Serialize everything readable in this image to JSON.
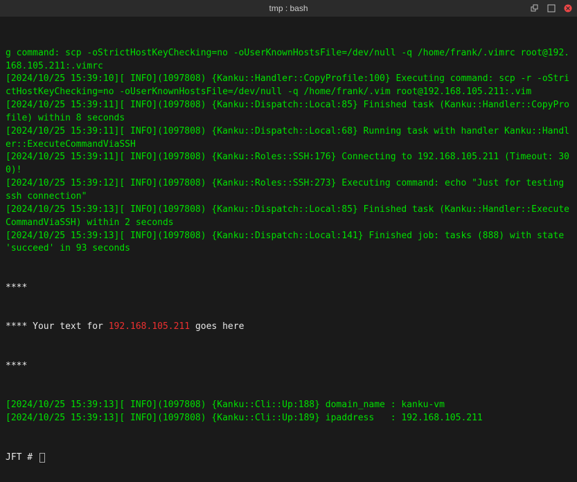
{
  "titlebar": {
    "title": "tmp : bash"
  },
  "lines": [
    {
      "cls": "green",
      "text": "g command: scp -oStrictHostKeyChecking=no -oUserKnownHostsFile=/dev/null -q /home/frank/.vimrc root@192.168.105.211:.vimrc"
    },
    {
      "cls": "green",
      "text": "[2024/10/25 15:39:10][ INFO](1097808) {Kanku::Handler::CopyProfile:100} Executing command: scp -r -oStrictHostKeyChecking=no -oUserKnownHostsFile=/dev/null -q /home/frank/.vim root@192.168.105.211:.vim"
    },
    {
      "cls": "green",
      "text": "[2024/10/25 15:39:11][ INFO](1097808) {Kanku::Dispatch::Local:85} Finished task (Kanku::Handler::CopyProfile) within 8 seconds"
    },
    {
      "cls": "green",
      "text": "[2024/10/25 15:39:11][ INFO](1097808) {Kanku::Dispatch::Local:68} Running task with handler Kanku::Handler::ExecuteCommandViaSSH"
    },
    {
      "cls": "green",
      "text": "[2024/10/25 15:39:11][ INFO](1097808) {Kanku::Roles::SSH:176} Connecting to 192.168.105.211 (Timeout: 300)!"
    },
    {
      "cls": "green",
      "text": "[2024/10/25 15:39:12][ INFO](1097808) {Kanku::Roles::SSH:273} Executing command: echo \"Just for testing ssh connection\""
    },
    {
      "cls": "green",
      "text": "[2024/10/25 15:39:13][ INFO](1097808) {Kanku::Dispatch::Local:85} Finished task (Kanku::Handler::ExecuteCommandViaSSH) within 2 seconds"
    },
    {
      "cls": "green",
      "text": "[2024/10/25 15:39:13][ INFO](1097808) {Kanku::Dispatch::Local:141} Finished job: tasks (888) with state 'succeed' in 93 seconds"
    }
  ],
  "banner": {
    "stars1": "****",
    "prefix": "**** ",
    "mid1": "Your text for ",
    "ip": "192.168.105.211",
    "mid2": " goes here",
    "stars2": "****"
  },
  "tail": [
    {
      "cls": "green",
      "text": "[2024/10/25 15:39:13][ INFO](1097808) {Kanku::Cli::Up:188} domain_name : kanku-vm"
    },
    {
      "cls": "green",
      "text": "[2024/10/25 15:39:13][ INFO](1097808) {Kanku::Cli::Up:189} ipaddress   : 192.168.105.211"
    }
  ],
  "prompt": {
    "text": "JFT # "
  }
}
